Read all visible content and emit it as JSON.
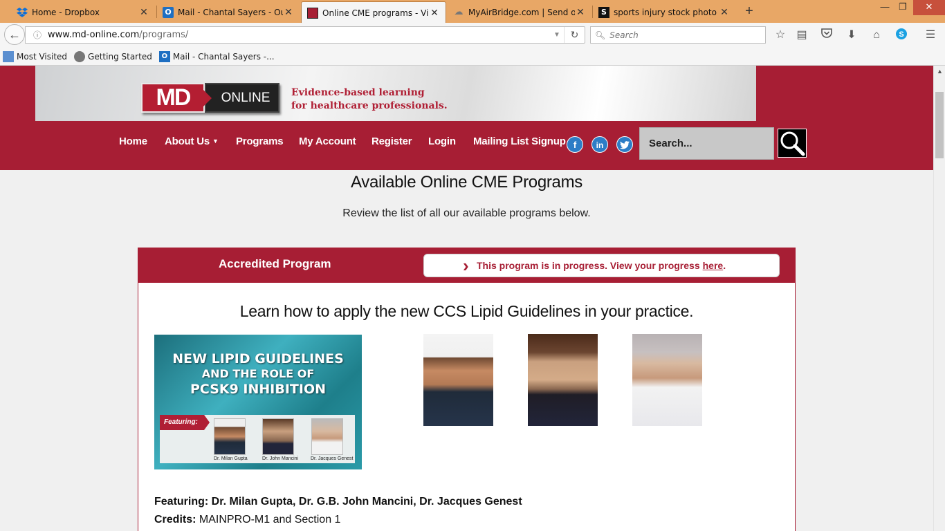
{
  "browser": {
    "tabs": [
      {
        "title": "Home - Dropbox",
        "icon": "dropbox-icon"
      },
      {
        "title": "Mail - Chantal Sayers - Ou...",
        "icon": "outlook-icon"
      },
      {
        "title": "Online CME programs - Vi...",
        "icon": "md-online-icon",
        "active": true
      },
      {
        "title": "MyAirBridge.com | Send o...",
        "icon": "airbridge-icon"
      },
      {
        "title": "sports injury stock photo ...",
        "icon": "istock-icon"
      }
    ],
    "url_domain": "www.md-online.com",
    "url_path": "/programs/",
    "search_placeholder": "Search",
    "bookmarks": [
      {
        "label": "Most Visited",
        "icon": "most-visited-icon"
      },
      {
        "label": "Getting Started",
        "icon": "firefox-globe-icon"
      },
      {
        "label": "Mail - Chantal Sayers -...",
        "icon": "outlook-icon"
      }
    ]
  },
  "site": {
    "logo_md": "MD",
    "logo_online": "ONLINE",
    "tagline_line1": "Evidence-based learning",
    "tagline_line2": "for healthcare professionals.",
    "nav": {
      "home": "Home",
      "about": "About Us",
      "programs": "Programs",
      "account": "My Account",
      "register": "Register",
      "login": "Login",
      "mailing": "Mailing List Signup"
    },
    "search_placeholder": "Search..."
  },
  "page": {
    "title": "Available Online CME Programs",
    "subtitle": "Review the list of all our available programs below.",
    "program": {
      "header_label": "Accredited Program",
      "progress_text": "This program is in progress. View your progress",
      "progress_link": "here",
      "headline": "Learn how to apply the new CCS Lipid Guidelines in your practice.",
      "promo_title_1": "NEW LIPID GUIDELINES",
      "promo_title_2": "AND THE ROLE OF",
      "promo_title_3": "PCSK9 INHIBITION",
      "promo_featuring": "Featuring:",
      "promo_captions": [
        "Dr. Milan Gupta",
        "Dr. John Mancini",
        "Dr. Jacques Genest"
      ],
      "featuring": "Featuring: Dr. Milan Gupta, Dr. G.B. John Mancini, Dr. Jacques Genest",
      "credits_label": "Credits:",
      "credits_value": "MAINPRO-M1 and Section 1"
    }
  },
  "colors": {
    "brand_red": "#a71e34",
    "tab_bar": "#e8a766",
    "social_blue": "#2d7dc6"
  }
}
